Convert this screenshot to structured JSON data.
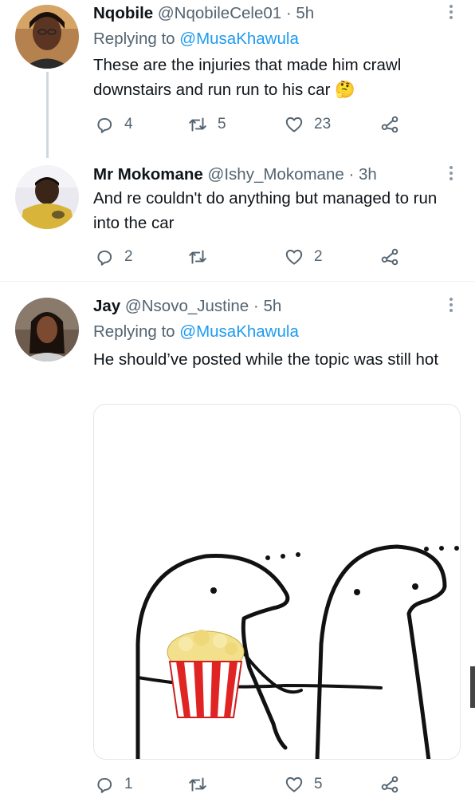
{
  "tweets": [
    {
      "name": "Nqobile",
      "handle": "@NqobileCele01",
      "dot": "·",
      "time": "5h",
      "replying_prefix": "Replying to",
      "replying_to": "@MusaKhawula",
      "text": "These are the injuries that made him crawl downstairs and run run to his car 🤔",
      "replies": "4",
      "retweets": "5",
      "likes": "23"
    },
    {
      "name": "Mr Mokomane",
      "handle": "@Ishy_Mokomane",
      "dot": "·",
      "time": "3h",
      "text": "And re couldn't do anything but managed to run into the car",
      "replies": "2",
      "retweets": "",
      "likes": "2"
    },
    {
      "name": "Jay",
      "handle": "@Nsovo_Justine",
      "dot": "·",
      "time": "5h",
      "replying_prefix": "Replying to",
      "replying_to": "@MusaKhawula",
      "text": "He should’ve posted while the topic was still hot",
      "replies": "1",
      "retweets": "",
      "likes": "5"
    }
  ],
  "icons": {
    "reply": "reply-icon",
    "retweet": "retweet-icon",
    "like": "heart-icon",
    "share": "share-icon",
    "more": "more-icon"
  },
  "colors": {
    "link": "#1d9bf0",
    "secondary_text": "#536471",
    "thread_line": "#cfd9de"
  }
}
